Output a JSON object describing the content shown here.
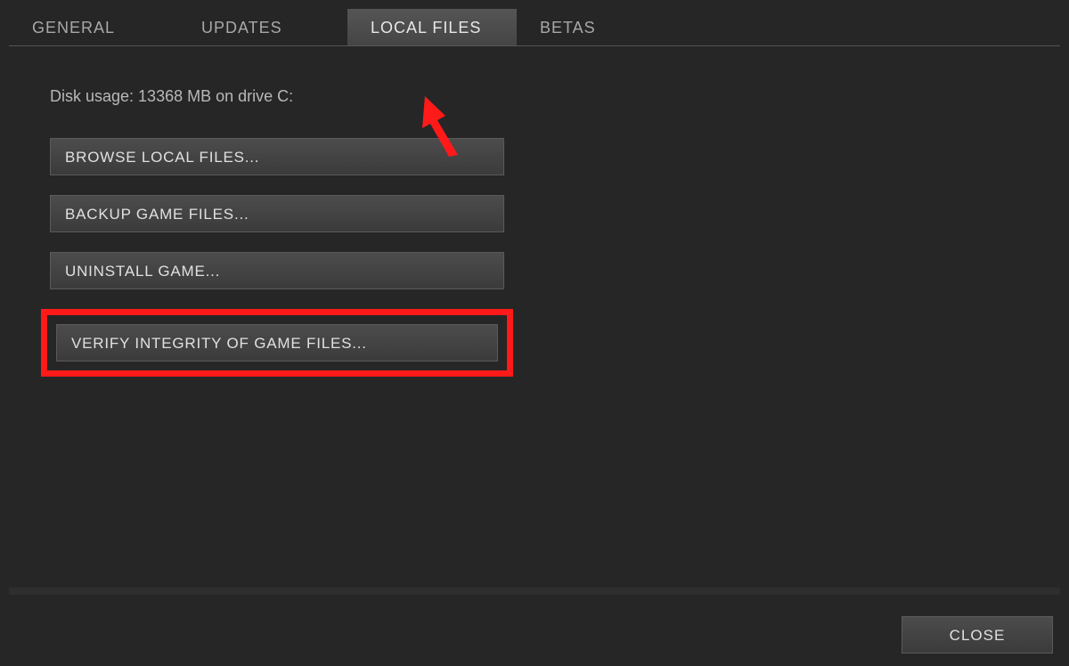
{
  "tabs": {
    "general": "GENERAL",
    "updates": "UPDATES",
    "local_files": "LOCAL FILES",
    "betas": "BETAS",
    "active": "local_files"
  },
  "panel": {
    "disk_usage": "Disk usage: 13368 MB on drive C:",
    "buttons": {
      "browse": "BROWSE LOCAL FILES...",
      "backup": "BACKUP GAME FILES...",
      "uninstall": "UNINSTALL GAME...",
      "verify": "VERIFY INTEGRITY OF GAME FILES..."
    }
  },
  "footer": {
    "close": "CLOSE"
  },
  "annotations": {
    "highlight_color": "#ff1a1a"
  }
}
